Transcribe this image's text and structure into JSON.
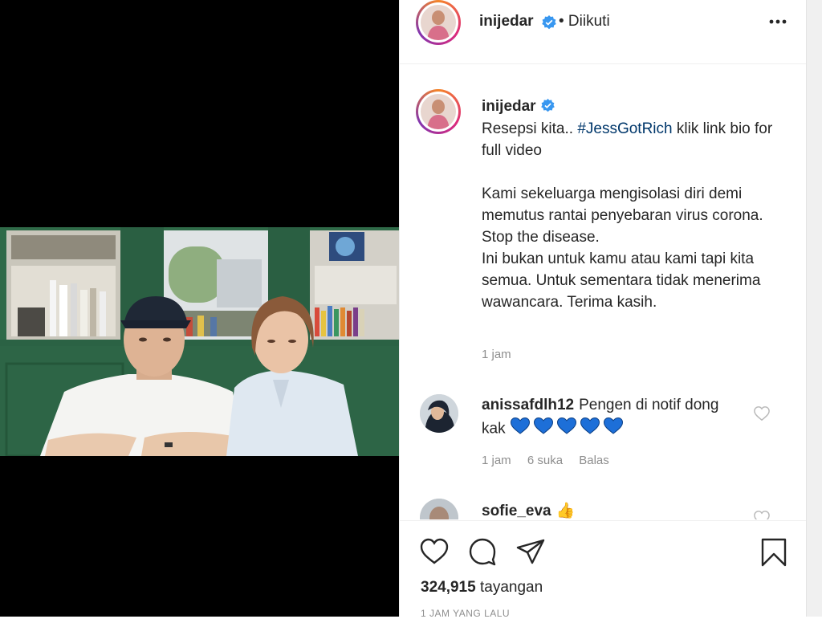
{
  "post": {
    "author": "inijedar",
    "follow_status": "• Diikuti",
    "view_count": "324,915",
    "view_label": "tayangan",
    "time_ago": "1 JAM YANG LALU"
  },
  "caption": {
    "username": "inijedar",
    "line1_prefix": "Resepsi kita.. ",
    "hashtag": "#JessGotRich",
    "line1_suffix": " klik link bio for full video",
    "paragraph2": "Kami sekeluarga mengisolasi diri demi memutus rantai penyebaran virus corona.",
    "paragraph3": "Stop the disease.",
    "paragraph4": "Ini bukan untuk kamu atau kami tapi kita semua. Untuk sementara tidak menerima wawancara. Terima kasih.",
    "time": "1 jam"
  },
  "comments": [
    {
      "username": "anissafdlh12",
      "text": "Pengen di notif dong kak",
      "emoji": "💙💙💙💙💙",
      "time": "1 jam",
      "likes": "6 suka",
      "reply": "Balas"
    },
    {
      "username": "sofie_eva",
      "text": "👍"
    }
  ],
  "colors": {
    "verified": "#3897f0",
    "heart_blue": "#1d6fd8",
    "hashtag": "#00376b",
    "meta": "#8e8e8e",
    "wall_green": "#2e6b4a"
  },
  "icons": {
    "more": "more-options-icon",
    "like": "heart-icon",
    "comment": "comment-icon",
    "share": "paper-plane-icon",
    "save": "bookmark-icon",
    "verified": "verified-badge-icon"
  }
}
